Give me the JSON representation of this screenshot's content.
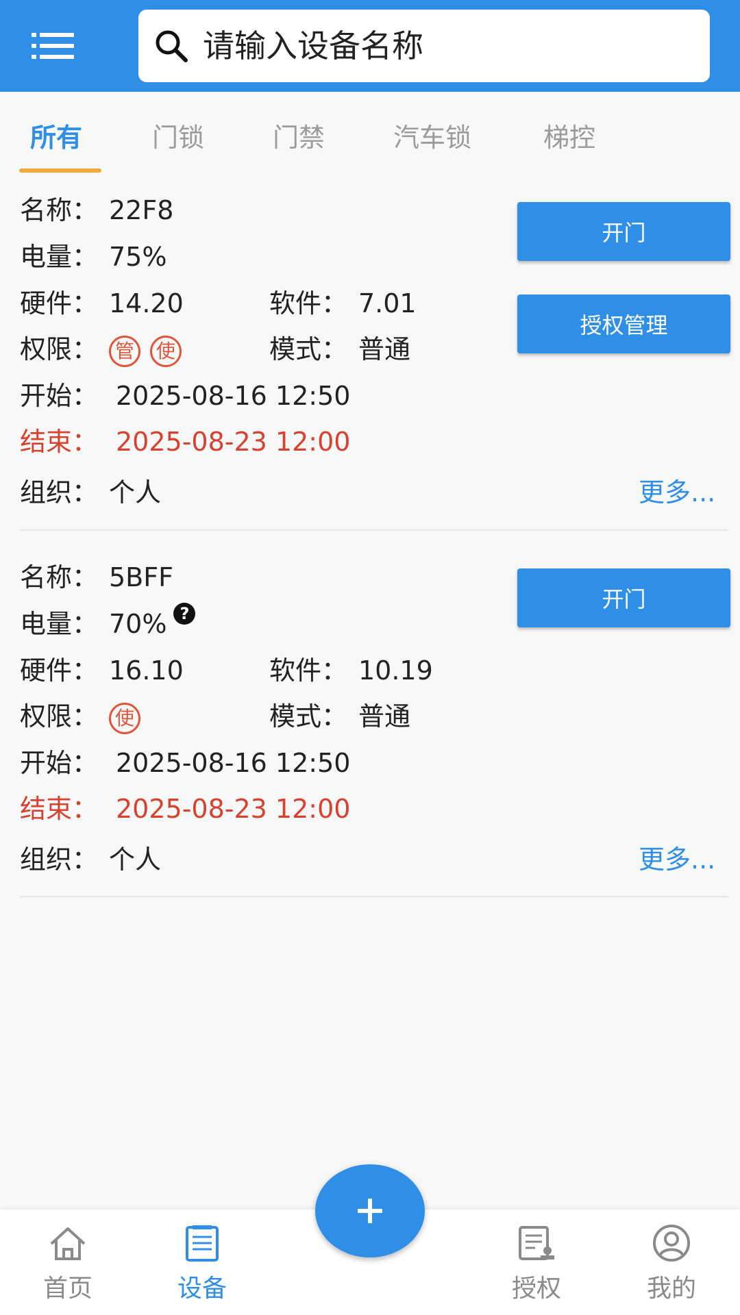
{
  "search": {
    "placeholder": "请输入设备名称"
  },
  "tabs": [
    "所有",
    "门锁",
    "门禁",
    "汽车锁",
    "梯控"
  ],
  "labels": {
    "name": "名称：",
    "battery": "电量：",
    "hardware": "硬件：",
    "software": "软件：",
    "permission": "权限：",
    "mode": "模式：",
    "start": "开始：",
    "end": "结束：",
    "org": "组织："
  },
  "badges": {
    "manage": "管",
    "use": "使"
  },
  "devices": [
    {
      "name": "22F8",
      "battery": "75%",
      "hardware": "14.20",
      "software": "7.01",
      "mode": "普通",
      "start": "2025-08-16 12:50",
      "end": "2025-08-23 12:00",
      "org": "个人",
      "open_label": "开门",
      "auth_label": "授权管理",
      "more_label": "更多..."
    },
    {
      "name": "5BFF",
      "battery": "70%",
      "help": "?",
      "hardware": "16.10",
      "software": "10.19",
      "mode": "普通",
      "start": "2025-08-16 12:50",
      "end": "2025-08-23 12:00",
      "org": "个人",
      "open_label": "开门",
      "more_label": "更多..."
    }
  ],
  "bottom_nav": [
    "首页",
    "设备",
    "授权",
    "我的"
  ],
  "fab_label": "+",
  "colors": {
    "primary": "#2f8fe6",
    "accent": "#f2a93b",
    "danger": "#d9412e"
  },
  "icons": [
    "menu-icon",
    "search-icon",
    "home-icon",
    "device-icon",
    "authorize-icon",
    "profile-icon",
    "plus-icon"
  ]
}
